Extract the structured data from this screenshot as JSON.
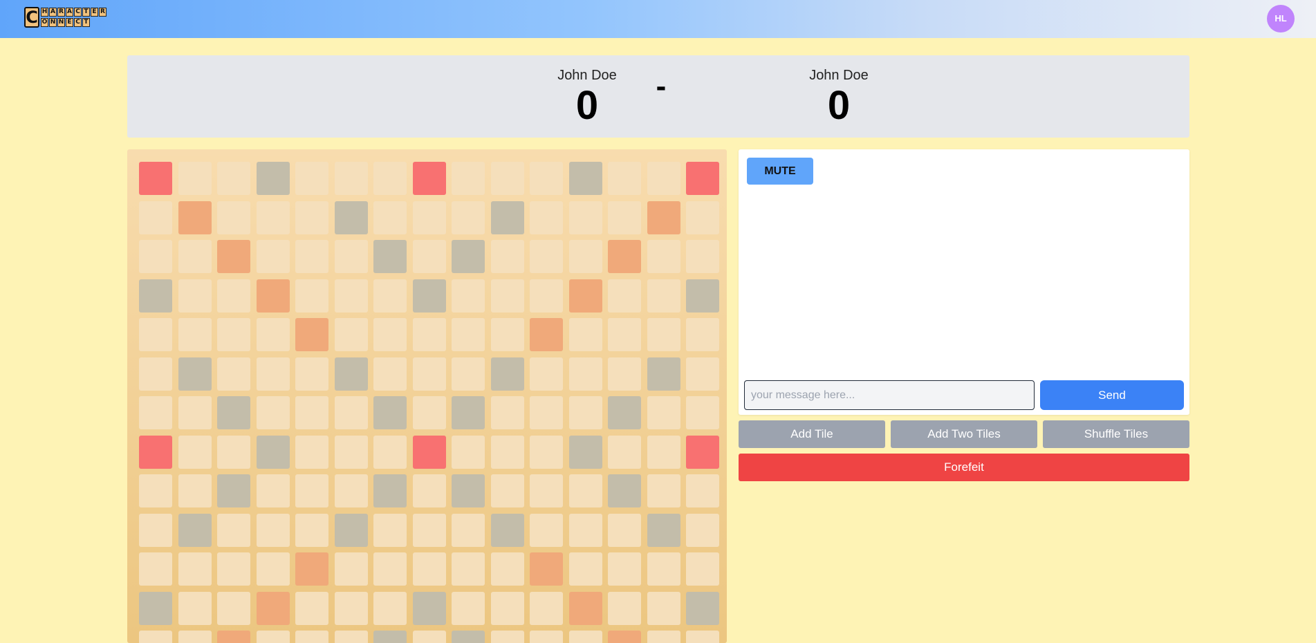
{
  "header": {
    "logo": {
      "big_letter": "C",
      "line1": "HARACTER",
      "line2": "ONNECT"
    },
    "avatar_initials": "HL"
  },
  "scoreboard": {
    "player1": {
      "name": "John Doe",
      "score": "0"
    },
    "separator": "-",
    "player2": {
      "name": "John Doe",
      "score": "0"
    }
  },
  "board": {
    "size": 15,
    "visible_rows": 13,
    "legend": {
      "n": "normal",
      "r": "red-bonus",
      "o": "orange-bonus",
      "g": "gray-bonus"
    },
    "rows": [
      "rnngnnnrnnngnnr",
      "nonnngnnngnnnon",
      "nnonnngngnnnonn",
      "gnnonnngnnnonng",
      "nnnnonnnnnonnnn",
      "ngnnngnnngnnngn",
      "nngnnngngnnngnn",
      "rnngnnnrnnngnnr",
      "nngnnngngnnngnn",
      "ngnnngnnngnnngn",
      "nnnnonnnnnonnnn",
      "gnnonnngnnnonng",
      "nnonnngngnnnonn"
    ],
    "colors": {
      "n": "#f5dfbb",
      "r": "#f87171",
      "o": "#f0a97a",
      "g": "#c3bdaa"
    }
  },
  "chat": {
    "mute_label": "MUTE",
    "message_placeholder": "your message here...",
    "message_value": "",
    "send_label": "Send"
  },
  "actions": {
    "add_tile": "Add Tile",
    "add_two_tiles": "Add Two Tiles",
    "shuffle_tiles": "Shuffle Tiles",
    "forfeit": "Forefeit"
  }
}
